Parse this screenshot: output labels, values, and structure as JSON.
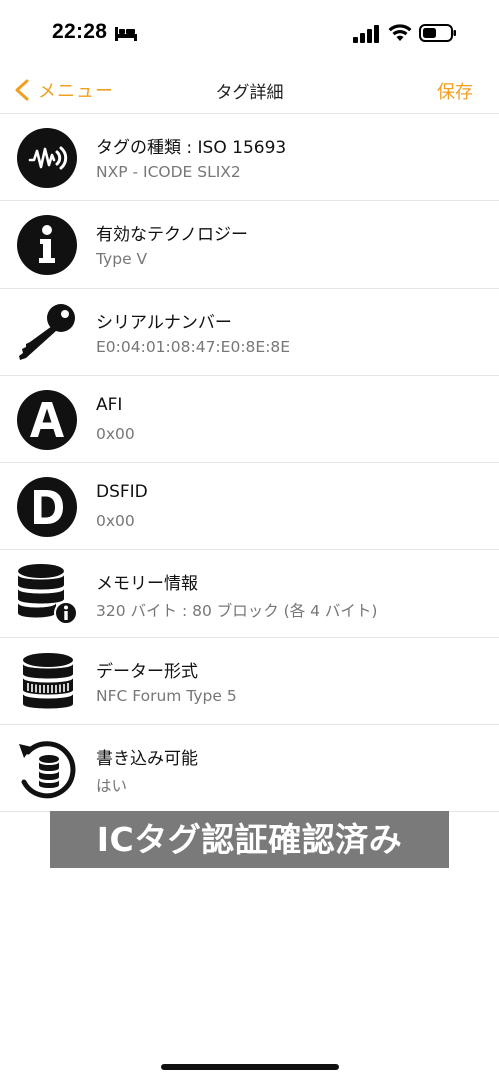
{
  "status_bar": {
    "time": "22:28"
  },
  "nav": {
    "back_label": "メニュー",
    "title": "タグ詳細",
    "save_label": "保存",
    "accent_color": "#f0a020"
  },
  "rows": [
    {
      "icon": "nfc-signal-icon",
      "title": "タグの種類 : ISO 15693",
      "value": "NXP - ICODE SLIX2"
    },
    {
      "icon": "info-icon",
      "title": "有効なテクノロジー",
      "value": "Type V"
    },
    {
      "icon": "key-icon",
      "title": "シリアルナンバー",
      "value": "E0:04:01:08:47:E0:8E:8E"
    },
    {
      "icon": "letter-a-icon",
      "title": "AFI",
      "value": "0x00"
    },
    {
      "icon": "letter-d-icon",
      "title": "DSFID",
      "value": "0x00"
    },
    {
      "icon": "database-info-icon",
      "title": "メモリー情報",
      "value": "320 バイト : 80 ブロック (各 4 バイト)"
    },
    {
      "icon": "database-format-icon",
      "title": "データー形式",
      "value": "NFC Forum Type 5"
    },
    {
      "icon": "database-refresh-icon",
      "title": "書き込み可能",
      "value": "はい"
    }
  ],
  "overlay_caption": "ICタグ認証確認済み"
}
